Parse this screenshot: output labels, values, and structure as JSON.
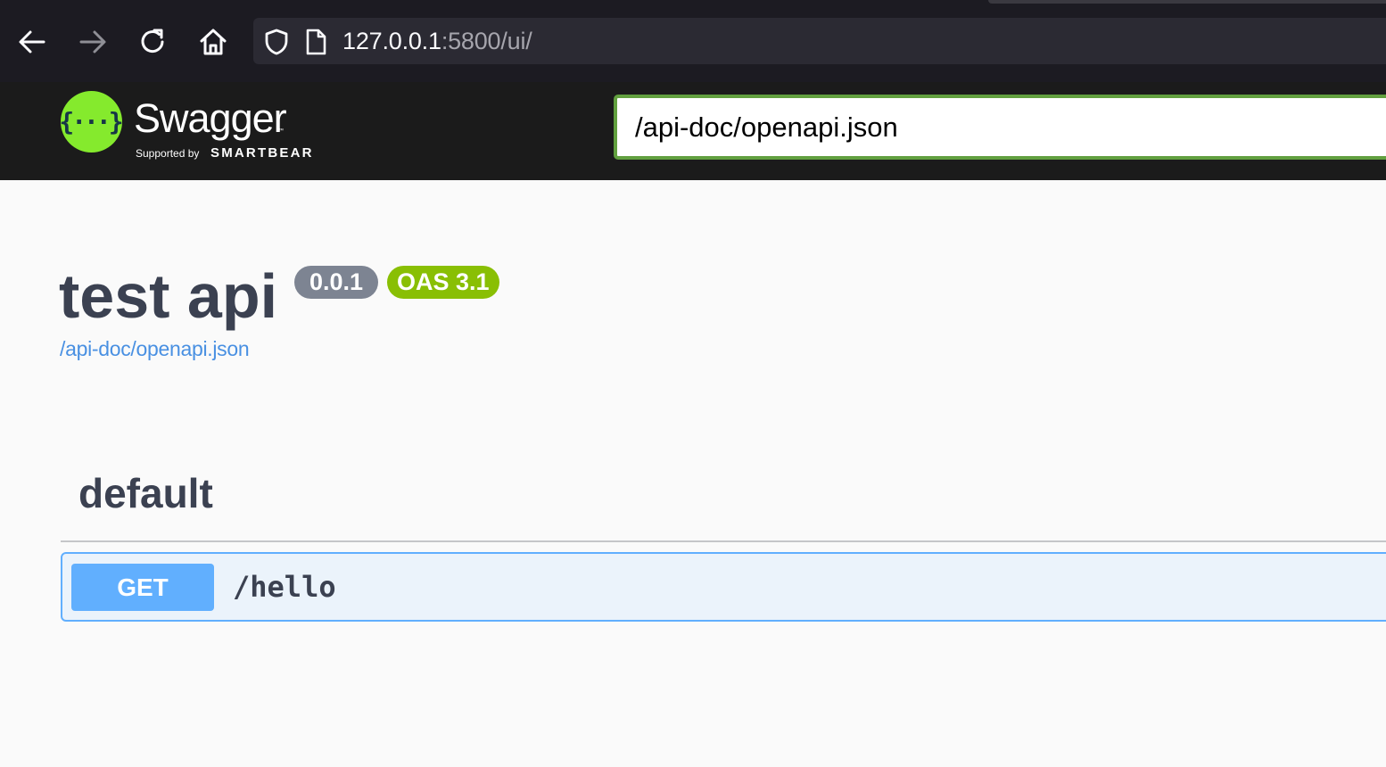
{
  "browser": {
    "url_host": "127.0.0.1",
    "url_rest": ":5800/ui/"
  },
  "topbar": {
    "brand_name": "Swagger",
    "brand_tm": "™",
    "supported_by": "Supported by",
    "company": "SMARTBEAR",
    "logo_glyph": "{···}",
    "spec_url_value": "/api-doc/openapi.json"
  },
  "info": {
    "title": "test api",
    "version": "0.0.1",
    "oas_version": "OAS 3.1",
    "spec_link": "/api-doc/openapi.json"
  },
  "operations": {
    "tag": "default",
    "items": [
      {
        "method": "GET",
        "path": "/hello"
      }
    ]
  },
  "colors": {
    "swagger_green": "#85ea2d",
    "get_blue": "#61affe",
    "badge_gray": "#7d8492",
    "oas_green": "#89bf04",
    "link_blue": "#4990e2"
  },
  "icons": [
    "back-arrow-icon",
    "forward-arrow-icon",
    "reload-icon",
    "home-icon",
    "shield-icon",
    "page-icon"
  ]
}
